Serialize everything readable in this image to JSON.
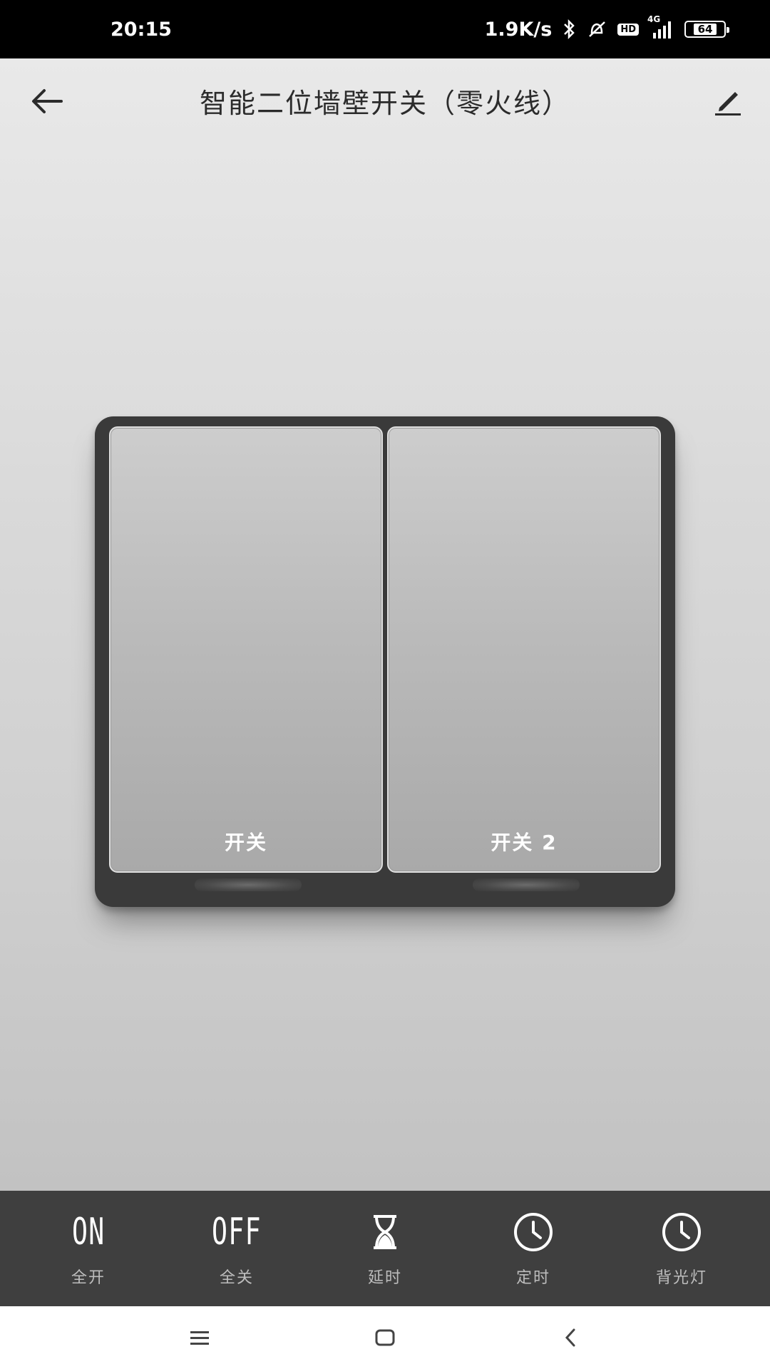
{
  "status_bar": {
    "time": "20:15",
    "network_speed": "1.9K/s",
    "hd_label": "HD",
    "signal_label": "4G",
    "battery_level": "64"
  },
  "header": {
    "title": "智能二位墙壁开关（零火线）"
  },
  "switches": [
    {
      "label": "开关"
    },
    {
      "label": "开关 2"
    }
  ],
  "actions": [
    {
      "icon_text": "ON",
      "label": "全开",
      "icon": "on-text-icon"
    },
    {
      "icon_text": "OFF",
      "label": "全关",
      "icon": "off-text-icon"
    },
    {
      "label": "延时",
      "icon": "hourglass-icon"
    },
    {
      "label": "定时",
      "icon": "clock-icon"
    },
    {
      "label": "背光灯",
      "icon": "clock-icon"
    }
  ],
  "colors": {
    "status_bar_bg": "#000000",
    "panel_frame": "#3a3a3a",
    "action_bar_bg": "#3f3f3f",
    "switch_face": "#b9b9b9"
  }
}
